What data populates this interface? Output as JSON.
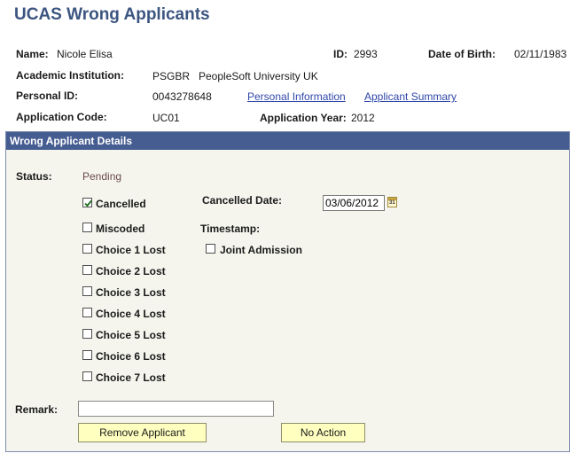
{
  "page": {
    "title": "UCAS Wrong Applicants"
  },
  "header": {
    "name_label": "Name:",
    "name_value": "Nicole Elisa",
    "id_label": "ID:",
    "id_value": "2993",
    "dob_label": "Date of Birth:",
    "dob_value": "02/11/1983",
    "institution_label": "Academic Institution:",
    "institution_code": "PSGBR",
    "institution_name": "PeopleSoft University UK",
    "personal_id_label": "Personal ID:",
    "personal_id_value": "0043278648",
    "personal_info_link": "Personal Information",
    "applicant_summary_link": "Applicant Summary",
    "app_code_label": "Application Code:",
    "app_code_value": "UC01",
    "app_year_label": "Application Year:",
    "app_year_value": "2012"
  },
  "details": {
    "header": "Wrong Applicant Details",
    "status_label": "Status:",
    "status_value": "Pending",
    "checkboxes": [
      {
        "label": "Cancelled",
        "checked": true
      },
      {
        "label": "Miscoded",
        "checked": false
      },
      {
        "label": "Choice 1 Lost",
        "checked": false
      },
      {
        "label": "Choice 2 Lost",
        "checked": false
      },
      {
        "label": "Choice 3 Lost",
        "checked": false
      },
      {
        "label": "Choice 4 Lost",
        "checked": false
      },
      {
        "label": "Choice 5 Lost",
        "checked": false
      },
      {
        "label": "Choice 6 Lost",
        "checked": false
      },
      {
        "label": "Choice 7 Lost",
        "checked": false
      }
    ],
    "cancelled_date_label": "Cancelled Date:",
    "cancelled_date_value": "03/06/2012",
    "calendar_icon_text": "31",
    "timestamp_label": "Timestamp:",
    "joint_admission_label": "Joint Admission",
    "joint_admission_checked": false,
    "remark_label": "Remark:",
    "remark_value": "",
    "remove_button": "Remove Applicant",
    "no_action_button": "No Action"
  }
}
